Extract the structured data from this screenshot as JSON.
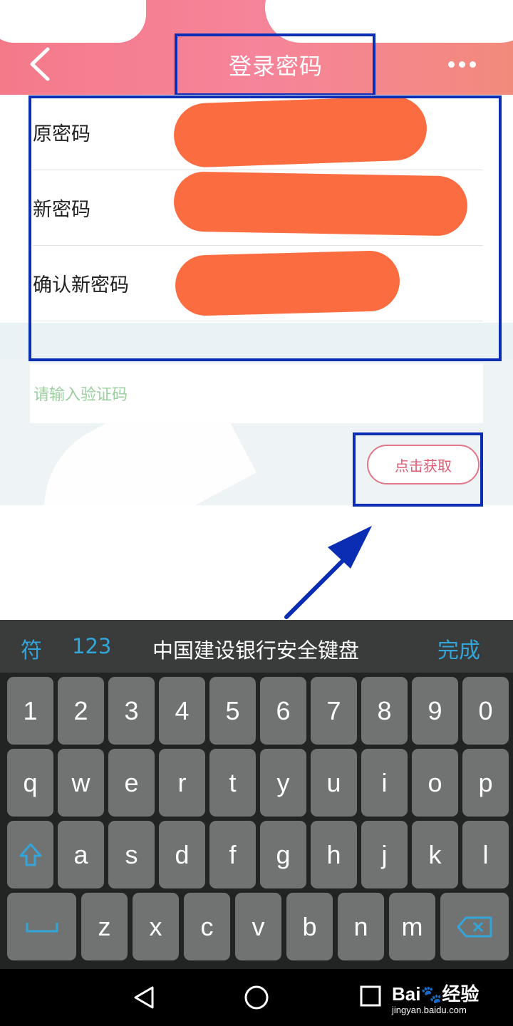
{
  "header": {
    "title": "登录密码",
    "back_icon": "chevron-left-icon",
    "more_icon": "more-dots-icon"
  },
  "form": {
    "rows": [
      {
        "label": "原密码"
      },
      {
        "label": "新密码"
      },
      {
        "label": "确认新密码"
      }
    ],
    "verification_placeholder": "请输入验证码",
    "get_code_label": "点击获取"
  },
  "keyboard": {
    "symbol_key": "符",
    "number_key": "123",
    "title": "中国建设银行安全键盘",
    "done": "完成",
    "row1": [
      "1",
      "2",
      "3",
      "4",
      "5",
      "6",
      "7",
      "8",
      "9",
      "0"
    ],
    "row2": [
      "q",
      "w",
      "e",
      "r",
      "t",
      "y",
      "u",
      "i",
      "o",
      "p"
    ],
    "row3": [
      "a",
      "s",
      "d",
      "f",
      "g",
      "h",
      "j",
      "k",
      "l"
    ],
    "row4": [
      "z",
      "x",
      "c",
      "v",
      "b",
      "n",
      "m"
    ]
  },
  "watermark": {
    "brand": "Bai",
    "brand_suffix": "经验",
    "url": "jingyan.baidu.com"
  },
  "colors": {
    "header": "#f6849a",
    "annotation": "#0b2db3",
    "redaction": "#fb6d40",
    "accent": "#33a5d8"
  }
}
